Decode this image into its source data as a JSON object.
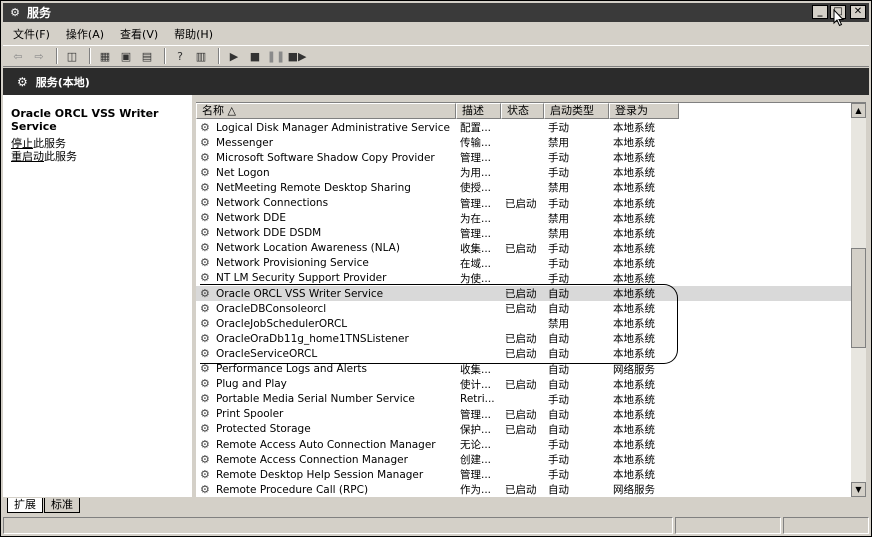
{
  "window": {
    "title": "服务",
    "icon": "services-icon"
  },
  "menu": [
    "文件(F)",
    "操作(A)",
    "查看(V)",
    "帮助(H)"
  ],
  "header": {
    "title": "服务(本地)"
  },
  "left_panel": {
    "service_name": "Oracle ORCL VSS Writer Service",
    "stop_link_underlined": "停止",
    "stop_link_rest": "此服务",
    "restart_link_underlined": "重启动",
    "restart_link_rest": "此服务"
  },
  "columns": [
    "名称 △",
    "描述",
    "状态",
    "启动类型",
    "登录为"
  ],
  "rows": [
    {
      "name": "Logical Disk Manager Administrative Service",
      "desc": "配置...",
      "status": "",
      "startup": "手动",
      "logon": "本地系统"
    },
    {
      "name": "Messenger",
      "desc": "传输...",
      "status": "",
      "startup": "禁用",
      "logon": "本地系统"
    },
    {
      "name": "Microsoft Software Shadow Copy Provider",
      "desc": "管理...",
      "status": "",
      "startup": "手动",
      "logon": "本地系统"
    },
    {
      "name": "Net Logon",
      "desc": "为用...",
      "status": "",
      "startup": "手动",
      "logon": "本地系统"
    },
    {
      "name": "NetMeeting Remote Desktop Sharing",
      "desc": "使授...",
      "status": "",
      "startup": "禁用",
      "logon": "本地系统"
    },
    {
      "name": "Network Connections",
      "desc": "管理...",
      "status": "已启动",
      "startup": "手动",
      "logon": "本地系统"
    },
    {
      "name": "Network DDE",
      "desc": "为在...",
      "status": "",
      "startup": "禁用",
      "logon": "本地系统"
    },
    {
      "name": "Network DDE DSDM",
      "desc": "管理...",
      "status": "",
      "startup": "禁用",
      "logon": "本地系统"
    },
    {
      "name": "Network Location Awareness (NLA)",
      "desc": "收集...",
      "status": "已启动",
      "startup": "手动",
      "logon": "本地系统"
    },
    {
      "name": "Network Provisioning Service",
      "desc": "在域...",
      "status": "",
      "startup": "手动",
      "logon": "本地系统"
    },
    {
      "name": "NT LM Security Support Provider",
      "desc": "为使...",
      "status": "",
      "startup": "手动",
      "logon": "本地系统"
    },
    {
      "name": "Oracle ORCL VSS Writer Service",
      "desc": "",
      "status": "已启动",
      "startup": "自动",
      "logon": "本地系统",
      "selected": true
    },
    {
      "name": "OracleDBConsoleorcl",
      "desc": "",
      "status": "已启动",
      "startup": "自动",
      "logon": "本地系统"
    },
    {
      "name": "OracleJobSchedulerORCL",
      "desc": "",
      "status": "",
      "startup": "禁用",
      "logon": "本地系统"
    },
    {
      "name": "OracleOraDb11g_home1TNSListener",
      "desc": "",
      "status": "已启动",
      "startup": "自动",
      "logon": "本地系统"
    },
    {
      "name": "OracleServiceORCL",
      "desc": "",
      "status": "已启动",
      "startup": "自动",
      "logon": "本地系统"
    },
    {
      "name": "Performance Logs and Alerts",
      "desc": "收集...",
      "status": "",
      "startup": "自动",
      "logon": "网络服务"
    },
    {
      "name": "Plug and Play",
      "desc": "使计...",
      "status": "已启动",
      "startup": "自动",
      "logon": "本地系统"
    },
    {
      "name": "Portable Media Serial Number Service",
      "desc": "Retri...",
      "status": "",
      "startup": "手动",
      "logon": "本地系统"
    },
    {
      "name": "Print Spooler",
      "desc": "管理...",
      "status": "已启动",
      "startup": "自动",
      "logon": "本地系统"
    },
    {
      "name": "Protected Storage",
      "desc": "保护...",
      "status": "已启动",
      "startup": "自动",
      "logon": "本地系统"
    },
    {
      "name": "Remote Access Auto Connection Manager",
      "desc": "无论...",
      "status": "",
      "startup": "手动",
      "logon": "本地系统"
    },
    {
      "name": "Remote Access Connection Manager",
      "desc": "创建...",
      "status": "",
      "startup": "手动",
      "logon": "本地系统"
    },
    {
      "name": "Remote Desktop Help Session Manager",
      "desc": "管理...",
      "status": "",
      "startup": "手动",
      "logon": "本地系统"
    },
    {
      "name": "Remote Procedure Call (RPC)",
      "desc": "作为...",
      "status": "已启动",
      "startup": "自动",
      "logon": "网络服务"
    }
  ],
  "tabs": [
    "扩展",
    "标准"
  ],
  "active_tab": 0
}
